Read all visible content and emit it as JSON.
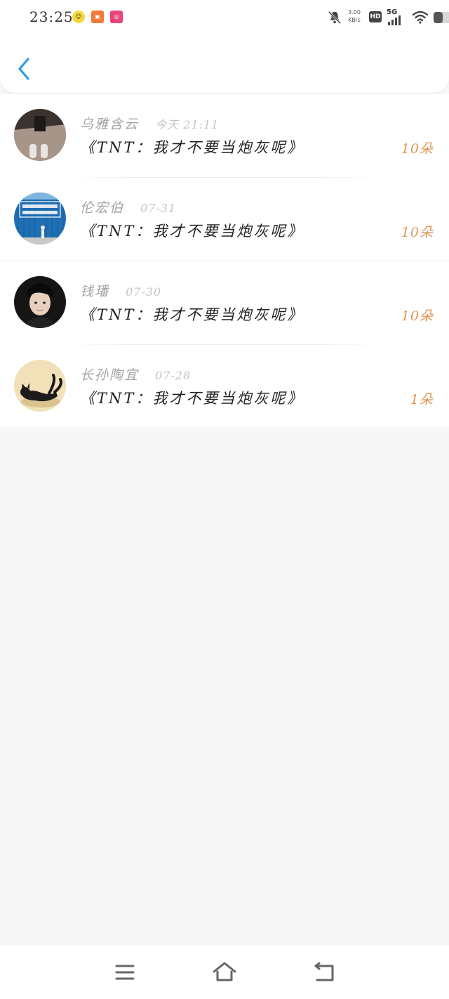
{
  "status_bar": {
    "time": "23:25",
    "net_speed_value": "3.00",
    "net_speed_unit": "KB/s",
    "hd_label": "HD",
    "network_label": "5G",
    "icons": [
      "notification-app-icon",
      "store-app-icon",
      "weibo-app-icon",
      "bell-muted-icon",
      "signal-icon",
      "wifi-icon",
      "battery-icon"
    ]
  },
  "header": {
    "back_icon": "chevron-left-icon"
  },
  "colors": {
    "accent": "#2a9de0",
    "amount": "#e29655",
    "username": "#a3a3a3",
    "time": "#c4c4c4",
    "title": "#222222",
    "background": "#f8f7f8"
  },
  "list": {
    "items": [
      {
        "username": "乌雅含云",
        "time": "今天 21:11",
        "title": "《TNT：我才不要当炮灰呢》",
        "amount": "10朵"
      },
      {
        "username": "伦宏伯",
        "time": "07-31",
        "title": "《TNT：我才不要当炮灰呢》",
        "amount": "10朵"
      },
      {
        "username": "钱璠",
        "time": "07-30",
        "title": "《TNT：我才不要当炮灰呢》",
        "amount": "10朵"
      },
      {
        "username": "长孙陶宜",
        "time": "07-28",
        "title": "《TNT：我才不要当炮灰呢》",
        "amount": "1朵"
      }
    ]
  },
  "nav_bar": {
    "icons": [
      "menu-icon",
      "home-icon",
      "back-icon"
    ]
  }
}
